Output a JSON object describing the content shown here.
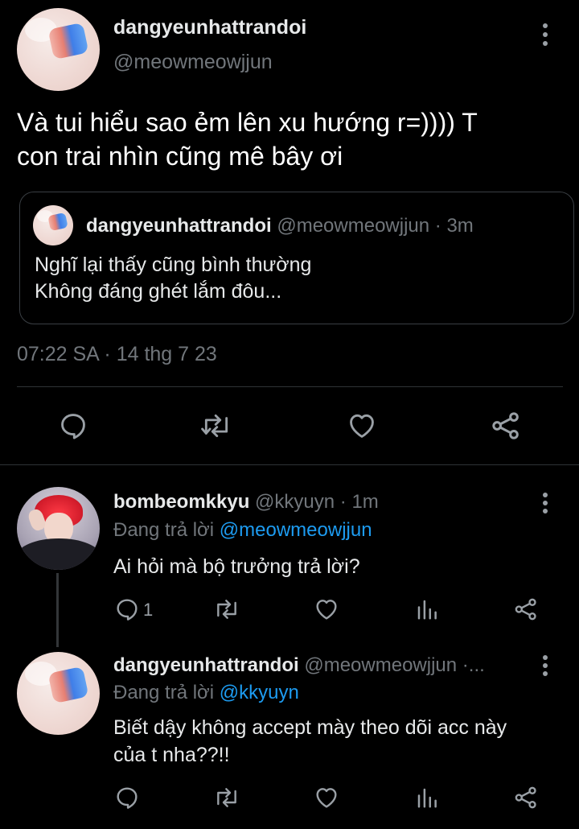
{
  "main_tweet": {
    "display_name": "dangyeunhattrandoi",
    "handle": "@meowmeowjjun",
    "text_line1": "Và tui hiểu sao ẻm lên xu hướng r=)))) T",
    "text_line2": "con trai nhìn cũng mê bây ơi",
    "quoted": {
      "display_name": "dangyeunhattrandoi",
      "handle": "@meowmeowjjun",
      "time": "· 3m",
      "line1": "Nghĩ lại thấy cũng bình thường",
      "line2": "Không đáng ghét lắm đôu..."
    },
    "timestamp": "07:22 SA · 14 thg 7 23",
    "actions": [
      "reply-icon",
      "retweet-icon",
      "like-icon",
      "share-icon"
    ]
  },
  "replies": [
    {
      "display_name": "bombeomkkyu",
      "handle": "@kkyuyn",
      "time": "· 1m",
      "replying_prefix": "Đang trả lời",
      "replying_to": "@meowmeowjjun",
      "text": "Ai hỏi mà bộ trưởng trả lời?",
      "reply_count": "1",
      "actions": [
        "reply-icon",
        "retweet-icon",
        "like-icon",
        "views-icon",
        "share-icon"
      ]
    },
    {
      "display_name": "dangyeunhattrandoi",
      "handle": "@meowmeowjjun",
      "time": "·...",
      "replying_prefix": "Đang trả lời",
      "replying_to": "@kkyuyn",
      "text_line1": "Biết dậy không accept mày theo dõi acc này",
      "text_line2": "của t nha??!!",
      "actions": [
        "reply-icon",
        "retweet-icon",
        "like-icon",
        "views-icon",
        "share-icon"
      ]
    }
  ],
  "colors": {
    "background": "#000000",
    "text": "#e7e9ea",
    "muted": "#71767b",
    "link": "#1d9bf0",
    "divider": "#2f3336"
  }
}
